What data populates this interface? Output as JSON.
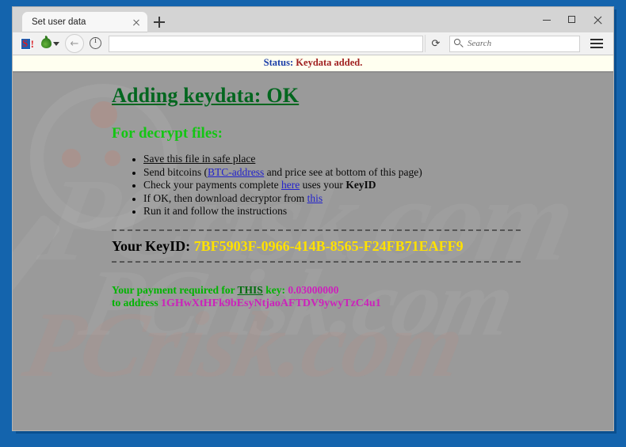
{
  "window": {
    "tab_title": "Set user data",
    "controls": {
      "minimize": "minimize-button",
      "maximize": "maximize-button",
      "close": "close-button"
    }
  },
  "toolbar": {
    "s_letter": "S",
    "s_bang": "!",
    "back_arrow": "←",
    "info_glyph": "i",
    "url_value": "",
    "reload_glyph": "⟳",
    "search_placeholder": "Search",
    "search_value": ""
  },
  "status": {
    "label": "Status:",
    "value": "Keydata added."
  },
  "page": {
    "title": "Adding keydata: OK",
    "subtitle": "For decrypt files:",
    "steps": [
      {
        "id": "save-file",
        "parts": [
          {
            "text": "Save this file in safe place",
            "style": "underline"
          }
        ]
      },
      {
        "id": "send-bitcoins",
        "parts": [
          {
            "text": "Send bitcoins (",
            "style": "plain"
          },
          {
            "text": "BTC-address",
            "style": "link"
          },
          {
            "text": " and price see at bottom of this page)",
            "style": "plain"
          }
        ]
      },
      {
        "id": "check-payments",
        "parts": [
          {
            "text": "Check your payments complete ",
            "style": "plain"
          },
          {
            "text": "here",
            "style": "link"
          },
          {
            "text": " uses your ",
            "style": "plain"
          },
          {
            "text": "KeyID",
            "style": "bold"
          }
        ]
      },
      {
        "id": "download-decryptor",
        "parts": [
          {
            "text": "If OK, then download decryptor from ",
            "style": "plain"
          },
          {
            "text": "this",
            "style": "link"
          }
        ]
      },
      {
        "id": "run-instructions",
        "parts": [
          {
            "text": "Run it and follow the instructions",
            "style": "plain"
          }
        ]
      }
    ],
    "keyid_label": "Your KeyID:",
    "keyid_value": "7BF5903F-0966-414B-8565-F24FB71EAFF9",
    "payment_prefix": "Your payment required for",
    "payment_this": "THIS",
    "payment_key_label": "key:",
    "payment_amount": "0.03000000",
    "payment_address_label": "to address",
    "payment_address": "1GHwXtHFk9bEsyNtjaoAFTDV9ywyTzC4u1",
    "watermark": "PCrisk.com"
  },
  "colors": {
    "desktop_blue": "#1464ad",
    "page_gray": "#9a9a9a",
    "status_bg": "#fffff0",
    "status_label": "#1b3ea8",
    "status_value": "#a02020",
    "title_green": "#00661e",
    "subtitle_green": "#13c613",
    "keyid_yellow": "#ffe100",
    "payment_green": "#00b400",
    "payment_magenta": "#cc22bb",
    "link_blue": "#2222cc"
  }
}
